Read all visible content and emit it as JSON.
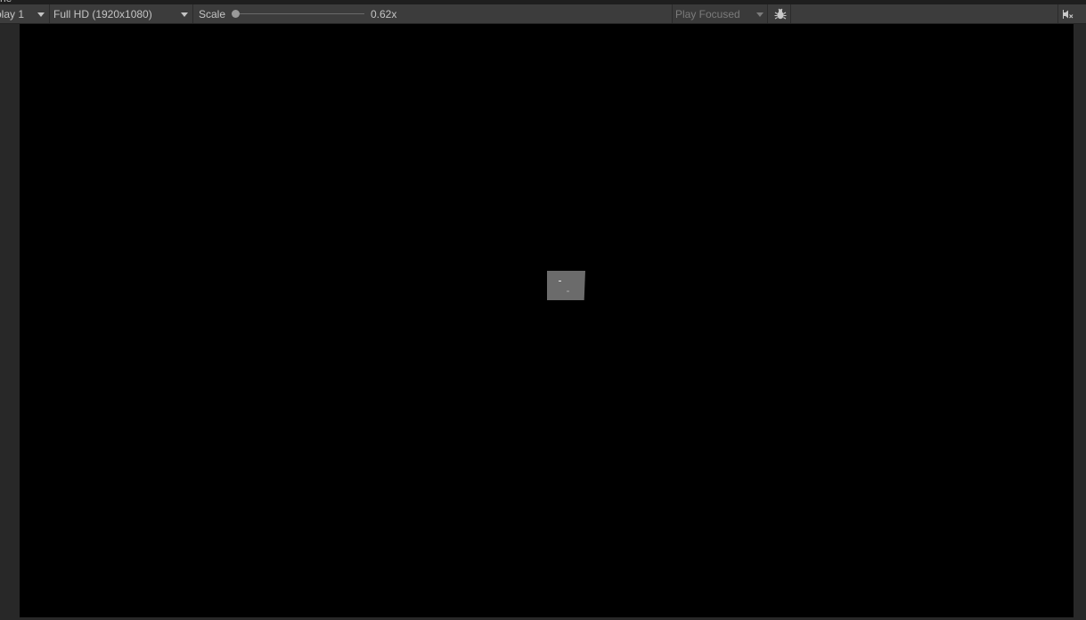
{
  "window": {
    "clipped_title": "ne"
  },
  "toolbar": {
    "display_dropdown": "olay 1",
    "resolution_dropdown": "Full HD (1920x1080)",
    "scale_label": "Scale",
    "scale_value": "0.62x",
    "scale_fraction": 0.0,
    "play_mode_dropdown": "Play Focused",
    "icons": {
      "bug": "bug-icon",
      "audio_gizmo": "audio-mute-icon"
    }
  },
  "colors": {
    "toolbar_bg": "#3c3c3c",
    "panel_bg": "#282828",
    "game_view_bg": "#000000",
    "text": "#c4c4c4",
    "disabled_text": "#7b7b7b"
  }
}
